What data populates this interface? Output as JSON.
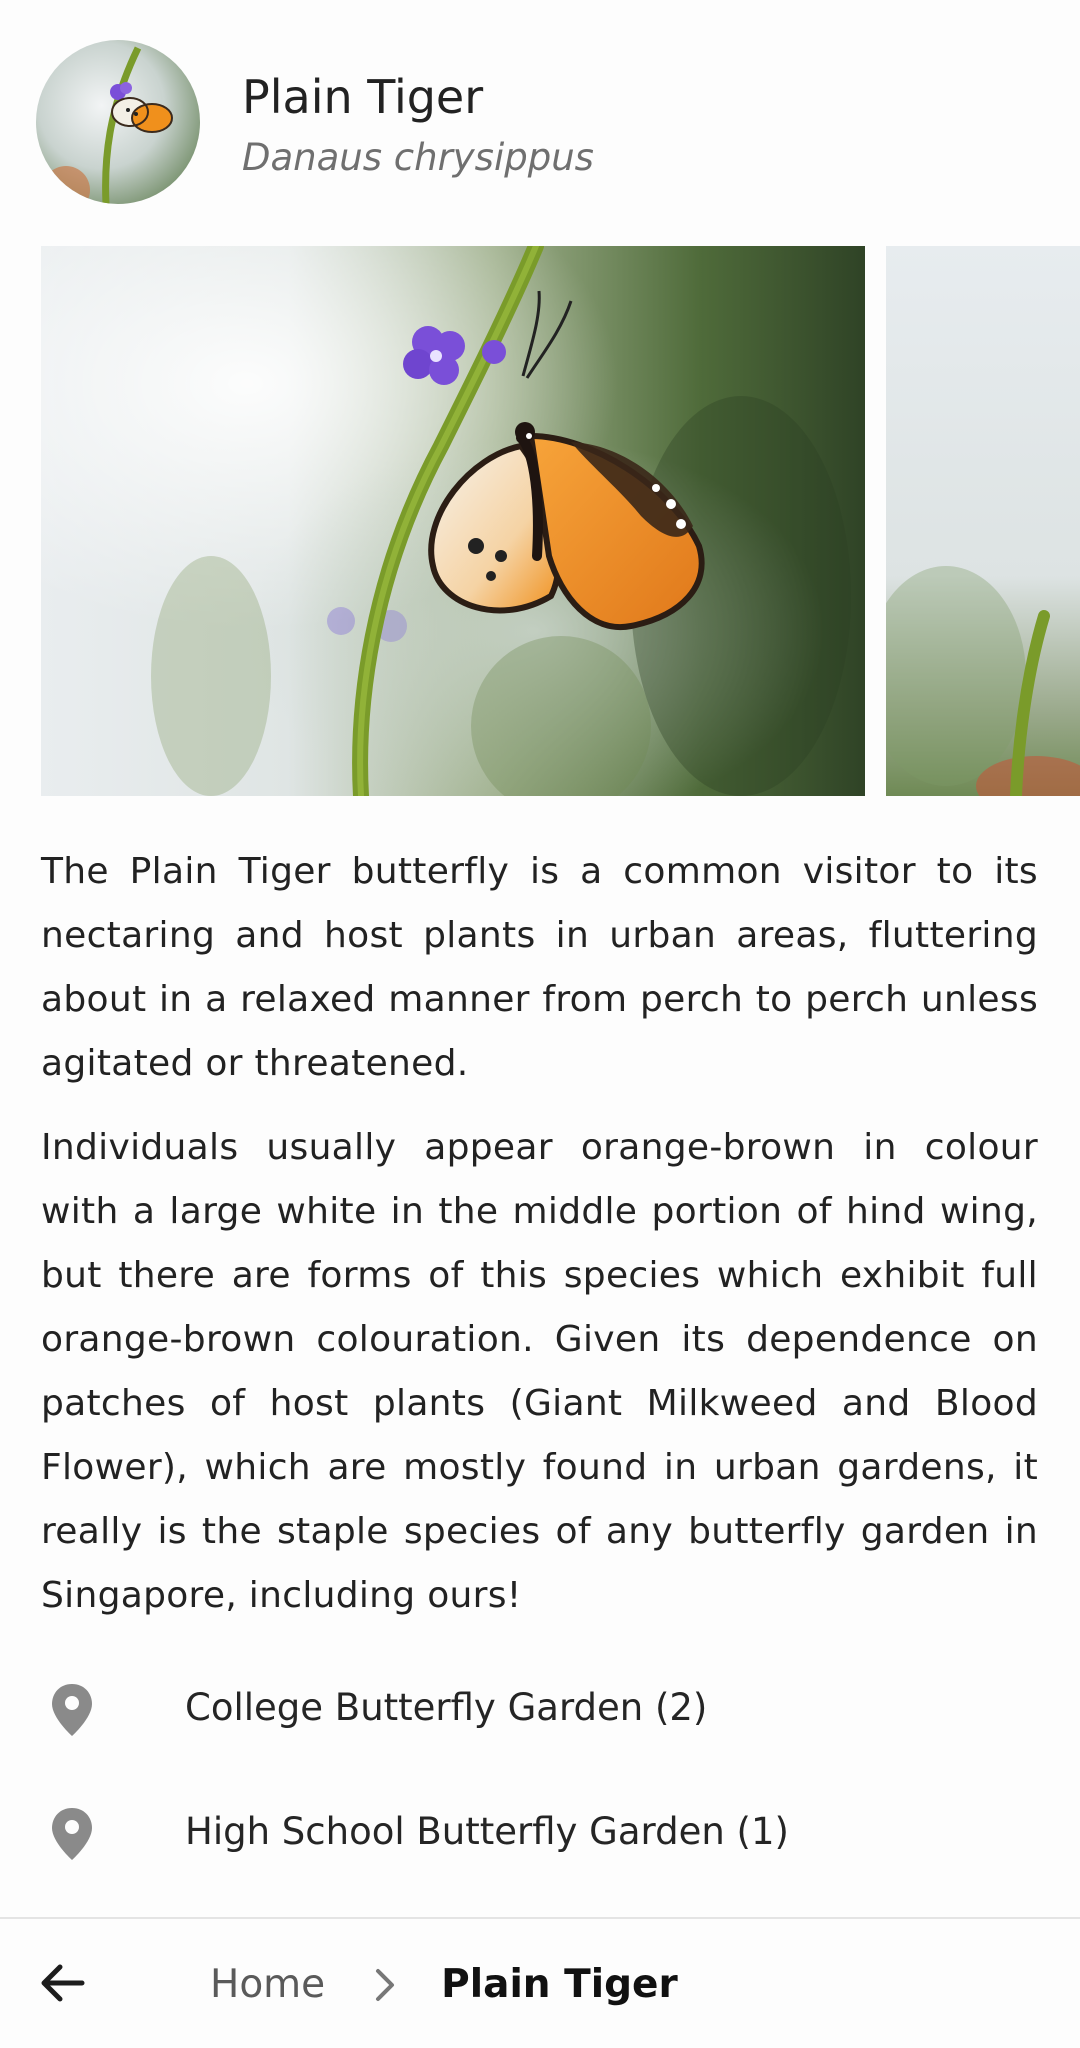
{
  "header": {
    "title": "Plain Tiger",
    "subtitle": "Danaus chrysippus"
  },
  "gallery": {
    "images": [
      "butterfly-photo-icon",
      "butterfly-photo-icon"
    ]
  },
  "description": {
    "paragraphs": [
      "The Plain Tiger butterfly is a common visitor to its nectaring and host plants in urban areas, fluttering about in a relaxed manner from perch to perch unless agitated or threatened.",
      "Individuals usually appear orange-brown in colour with a large white in the middle portion of hind wing, but there are forms of this species which exhibit full orange-brown colouration. Given its dependence on patches of host plants (Giant Milkweed and Blood Flower), which are mostly found in urban gardens, it really is the staple species of any butterfly garden in Singapore, including ours!"
    ]
  },
  "locations": [
    {
      "label": "College Butterfly Garden (2)",
      "icon": "location-pin-icon"
    },
    {
      "label": "High School Butterfly Garden (1)",
      "icon": "location-pin-icon"
    }
  ],
  "bottom_bar": {
    "back_icon": "arrow-left-icon",
    "breadcrumb": {
      "home": "Home",
      "separator_icon": "chevron-right-icon",
      "current": "Plain Tiger"
    }
  },
  "colors": {
    "butterfly_orange": "#f0901c",
    "stem_green": "#7a9b2a",
    "flower_purple": "#7a4fd8",
    "pin_gray": "#8a8a8a"
  }
}
